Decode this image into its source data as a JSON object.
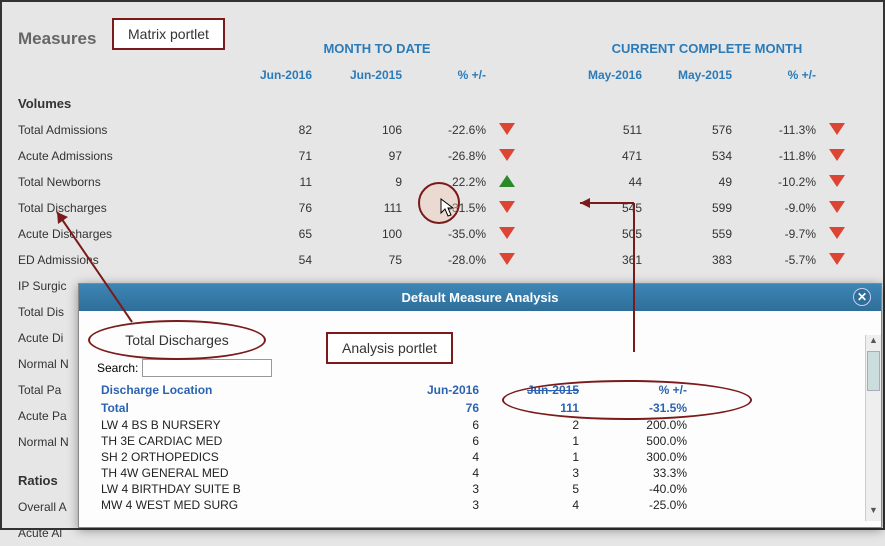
{
  "header": {
    "measures": "Measures",
    "mtd": "MONTH TO DATE",
    "ccm": "CURRENT COMPLETE MONTH"
  },
  "subhead": {
    "mtd_a": "Jun-2016",
    "mtd_b": "Jun-2015",
    "ccm_a": "May-2016",
    "ccm_b": "May-2015",
    "pct": "% +/-"
  },
  "groups": {
    "volumes": "Volumes",
    "ratios": "Ratios"
  },
  "matrix": [
    {
      "label": "Total Admissions",
      "mtd_a": "82",
      "mtd_b": "106",
      "mtd_pct": "-22.6%",
      "mtd_dir": "down",
      "ccm_a": "511",
      "ccm_b": "576",
      "ccm_pct": "-11.3%",
      "ccm_dir": "down"
    },
    {
      "label": "Acute Admissions",
      "mtd_a": "71",
      "mtd_b": "97",
      "mtd_pct": "-26.8%",
      "mtd_dir": "down",
      "ccm_a": "471",
      "ccm_b": "534",
      "ccm_pct": "-11.8%",
      "ccm_dir": "down"
    },
    {
      "label": "Total Newborns",
      "mtd_a": "11",
      "mtd_b": "9",
      "mtd_pct": "22.2%",
      "mtd_dir": "up",
      "ccm_a": "44",
      "ccm_b": "49",
      "ccm_pct": "-10.2%",
      "ccm_dir": "down"
    },
    {
      "label": "Total Discharges",
      "mtd_a": "76",
      "mtd_b": "111",
      "mtd_pct": "-31.5%",
      "mtd_dir": "down",
      "ccm_a": "545",
      "ccm_b": "599",
      "ccm_pct": "-9.0%",
      "ccm_dir": "down"
    },
    {
      "label": "Acute Discharges",
      "mtd_a": "65",
      "mtd_b": "100",
      "mtd_pct": "-35.0%",
      "mtd_dir": "down",
      "ccm_a": "505",
      "ccm_b": "559",
      "ccm_pct": "-9.7%",
      "ccm_dir": "down"
    },
    {
      "label": "ED Admissions",
      "mtd_a": "54",
      "mtd_b": "75",
      "mtd_pct": "-28.0%",
      "mtd_dir": "down",
      "ccm_a": "361",
      "ccm_b": "383",
      "ccm_pct": "-5.7%",
      "ccm_dir": "down"
    }
  ],
  "matrix_partial": [
    "IP Surgic",
    "Total Dis",
    "Acute Di",
    "Normal N",
    "Total Pa",
    "Acute Pa",
    "Normal N"
  ],
  "ratio_partial": [
    "Overall A",
    "Acute Al"
  ],
  "callouts": {
    "matrix_portlet": "Matrix portlet",
    "analysis_portlet": "Analysis portlet",
    "total_discharges": "Total Discharges"
  },
  "portlet": {
    "title": "Default Measure Analysis",
    "search_label": "Search:",
    "search_value": "",
    "head_label": "Discharge Location",
    "head_a": "Jun-2016",
    "head_b": "Jun-2015",
    "head_pct": "% +/-",
    "total_label": "Total",
    "total_a": "76",
    "total_b": "111",
    "total_pct": "-31.5%",
    "rows": [
      {
        "label": "LW 4 BS B NURSERY",
        "a": "6",
        "b": "2",
        "pct": "200.0%"
      },
      {
        "label": "TH 3E CARDIAC MED",
        "a": "6",
        "b": "1",
        "pct": "500.0%"
      },
      {
        "label": "SH 2 ORTHOPEDICS",
        "a": "4",
        "b": "1",
        "pct": "300.0%"
      },
      {
        "label": "TH 4W GENERAL MED",
        "a": "4",
        "b": "3",
        "pct": "33.3%"
      },
      {
        "label": "LW 4 BIRTHDAY SUITE B",
        "a": "3",
        "b": "5",
        "pct": "-40.0%"
      },
      {
        "label": "MW 4 WEST MED SURG",
        "a": "3",
        "b": "4",
        "pct": "-25.0%"
      }
    ]
  }
}
